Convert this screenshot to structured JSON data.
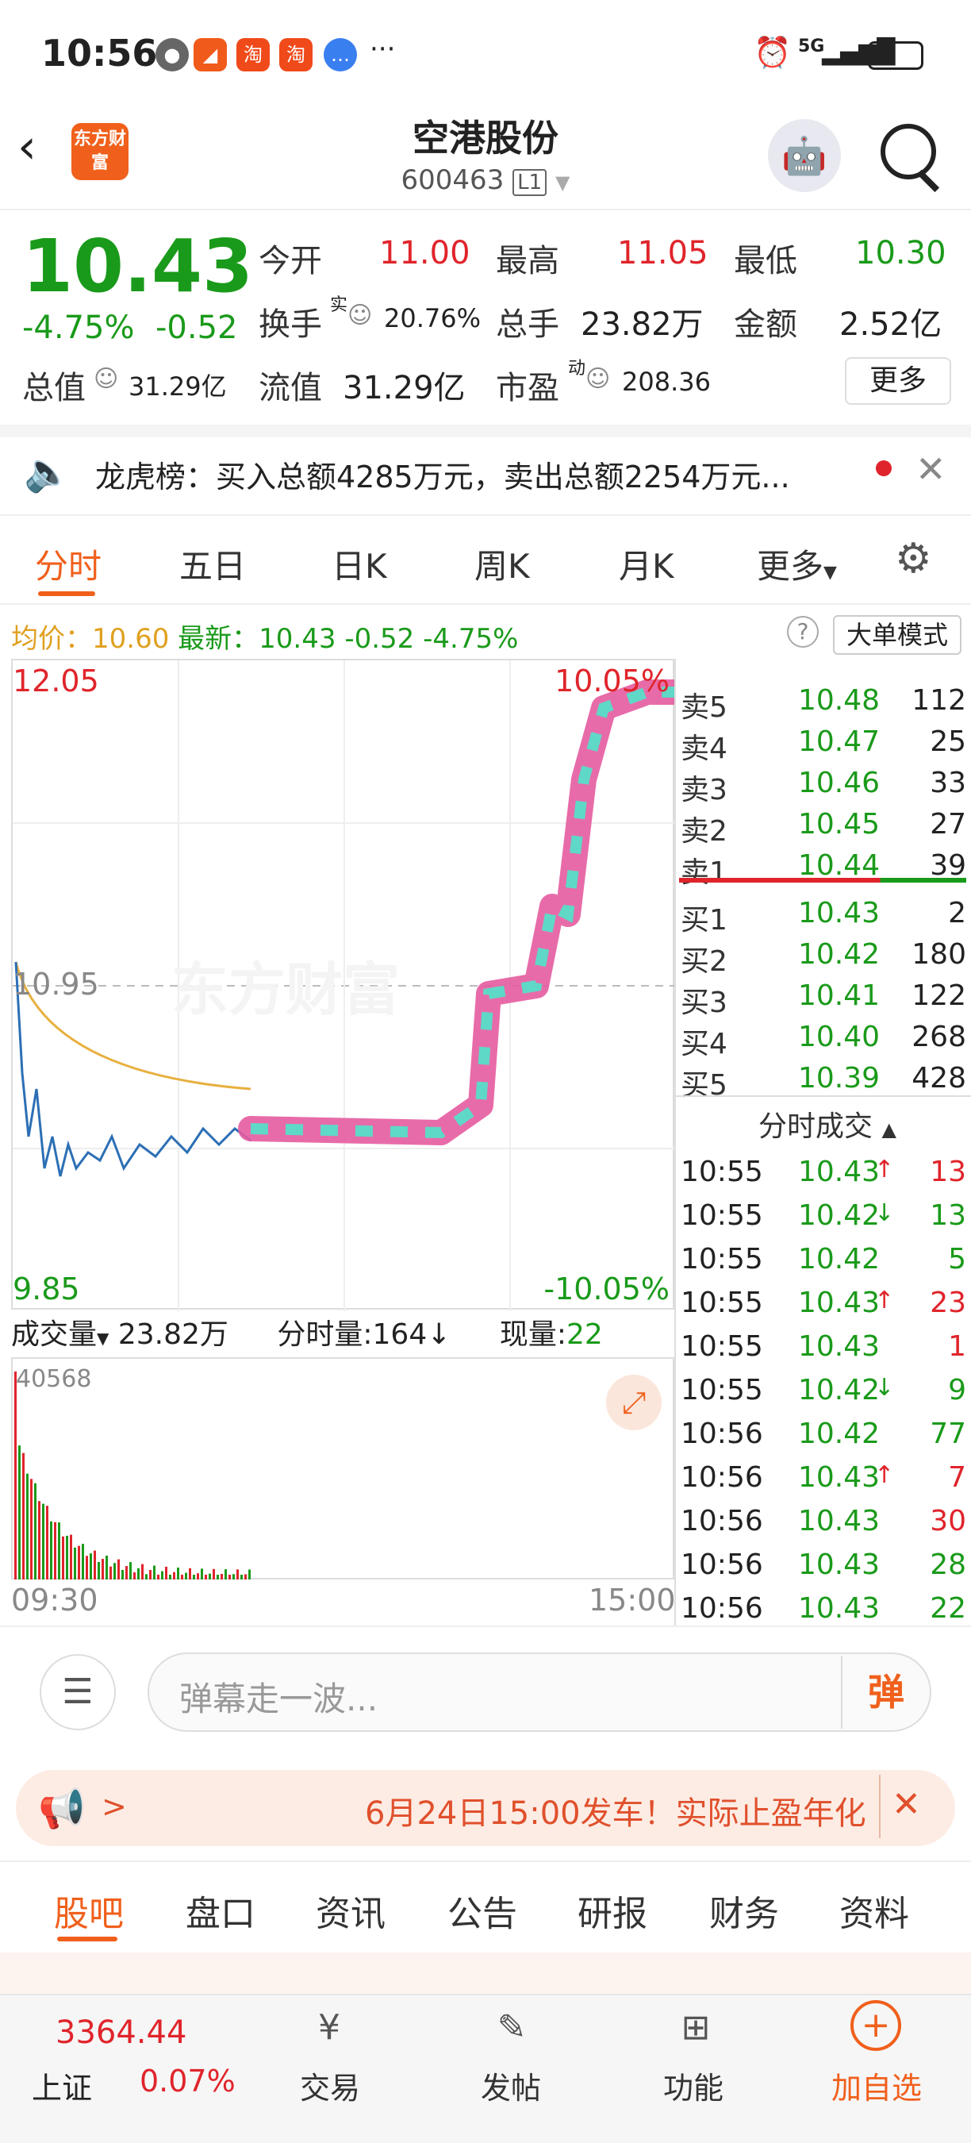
{
  "status_bar": {
    "time": "10:56",
    "network": "5G"
  },
  "header": {
    "logo": "东方财富",
    "title": "空港股份",
    "code": "600463",
    "level": "L1"
  },
  "quote": {
    "price": "10.43",
    "change_pct": "-4.75%",
    "change": "-0.52",
    "open_label": "今开",
    "open": "11.00",
    "high_label": "最高",
    "high": "11.05",
    "low_label": "最低",
    "low": "10.30",
    "turnover_label": "换手",
    "turnover_sup": "实",
    "turnover": "20.76%",
    "volume_label": "总手",
    "volume": "23.82万",
    "amount_label": "金额",
    "amount": "2.52亿",
    "mktcap_label": "总值",
    "mktcap": "31.29亿",
    "float_label": "流值",
    "float": "31.29亿",
    "pe_label": "市盈",
    "pe_sup": "动",
    "pe": "208.36",
    "more_label": "更多"
  },
  "notice": {
    "text": "龙虎榜：买入总额4285万元，卖出总额2254万元..."
  },
  "chart_tabs": [
    "分时",
    "五日",
    "日K",
    "周K",
    "月K",
    "更多"
  ],
  "avg_line": {
    "avg_label": "均价：",
    "avg": "10.60",
    "latest_label": "最新：",
    "latest": "10.43",
    "change": "-0.52",
    "pct": "-4.75%"
  },
  "big_order_mode": "大单模式",
  "chart": {
    "top_price": "12.05",
    "top_pct": "10.05%",
    "mid_price": "10.95",
    "bottom_price": "9.85",
    "bottom_pct": "-10.05%",
    "start_time": "09:30",
    "end_time": "15:00",
    "watermark": "东方财富"
  },
  "order_book": {
    "asks": [
      {
        "label": "卖5",
        "price": "10.48",
        "vol": "112"
      },
      {
        "label": "卖4",
        "price": "10.47",
        "vol": "25"
      },
      {
        "label": "卖3",
        "price": "10.46",
        "vol": "33"
      },
      {
        "label": "卖2",
        "price": "10.45",
        "vol": "27"
      },
      {
        "label": "卖1",
        "price": "10.44",
        "vol": "39"
      }
    ],
    "bids": [
      {
        "label": "买1",
        "price": "10.43",
        "vol": "2"
      },
      {
        "label": "买2",
        "price": "10.42",
        "vol": "180"
      },
      {
        "label": "买3",
        "price": "10.41",
        "vol": "122"
      },
      {
        "label": "买4",
        "price": "10.40",
        "vol": "268"
      },
      {
        "label": "买5",
        "price": "10.39",
        "vol": "428"
      }
    ]
  },
  "trades_header": "分时成交",
  "trades": [
    {
      "time": "10:55",
      "price": "10.43",
      "arrow": "↑",
      "vol": "13",
      "dir": "up"
    },
    {
      "time": "10:55",
      "price": "10.42",
      "arrow": "↓",
      "vol": "13",
      "dir": "down"
    },
    {
      "time": "10:55",
      "price": "10.42",
      "arrow": "",
      "vol": "5",
      "dir": "down"
    },
    {
      "time": "10:55",
      "price": "10.43",
      "arrow": "↑",
      "vol": "23",
      "dir": "up"
    },
    {
      "time": "10:55",
      "price": "10.43",
      "arrow": "",
      "vol": "1",
      "dir": "up"
    },
    {
      "time": "10:55",
      "price": "10.42",
      "arrow": "↓",
      "vol": "9",
      "dir": "down"
    },
    {
      "time": "10:56",
      "price": "10.42",
      "arrow": "",
      "vol": "77",
      "dir": "down"
    },
    {
      "time": "10:56",
      "price": "10.43",
      "arrow": "↑",
      "vol": "7",
      "dir": "up"
    },
    {
      "time": "10:56",
      "price": "10.43",
      "arrow": "",
      "vol": "30",
      "dir": "up"
    },
    {
      "time": "10:56",
      "price": "10.43",
      "arrow": "",
      "vol": "28",
      "dir": "down"
    },
    {
      "time": "10:56",
      "price": "10.43",
      "arrow": "",
      "vol": "22",
      "dir": "down"
    }
  ],
  "volume": {
    "label": "成交量",
    "total": "23.82万",
    "fs_label": "分时量:",
    "fs": "164",
    "cur_label": "现量:",
    "cur": "22",
    "max": "40568"
  },
  "danmaku": {
    "placeholder": "弹幕走一波...",
    "button": "弹"
  },
  "promo": {
    "text": "6月24日15:00发车！实际止盈年化"
  },
  "bottom_tabs": [
    "股吧",
    "盘口",
    "资讯",
    "公告",
    "研报",
    "财务",
    "资料"
  ],
  "index": {
    "value": "3364.44",
    "name": "上证",
    "pct": "0.07%"
  },
  "bottom_nav": [
    "交易",
    "发帖",
    "功能",
    "加自选"
  ]
}
